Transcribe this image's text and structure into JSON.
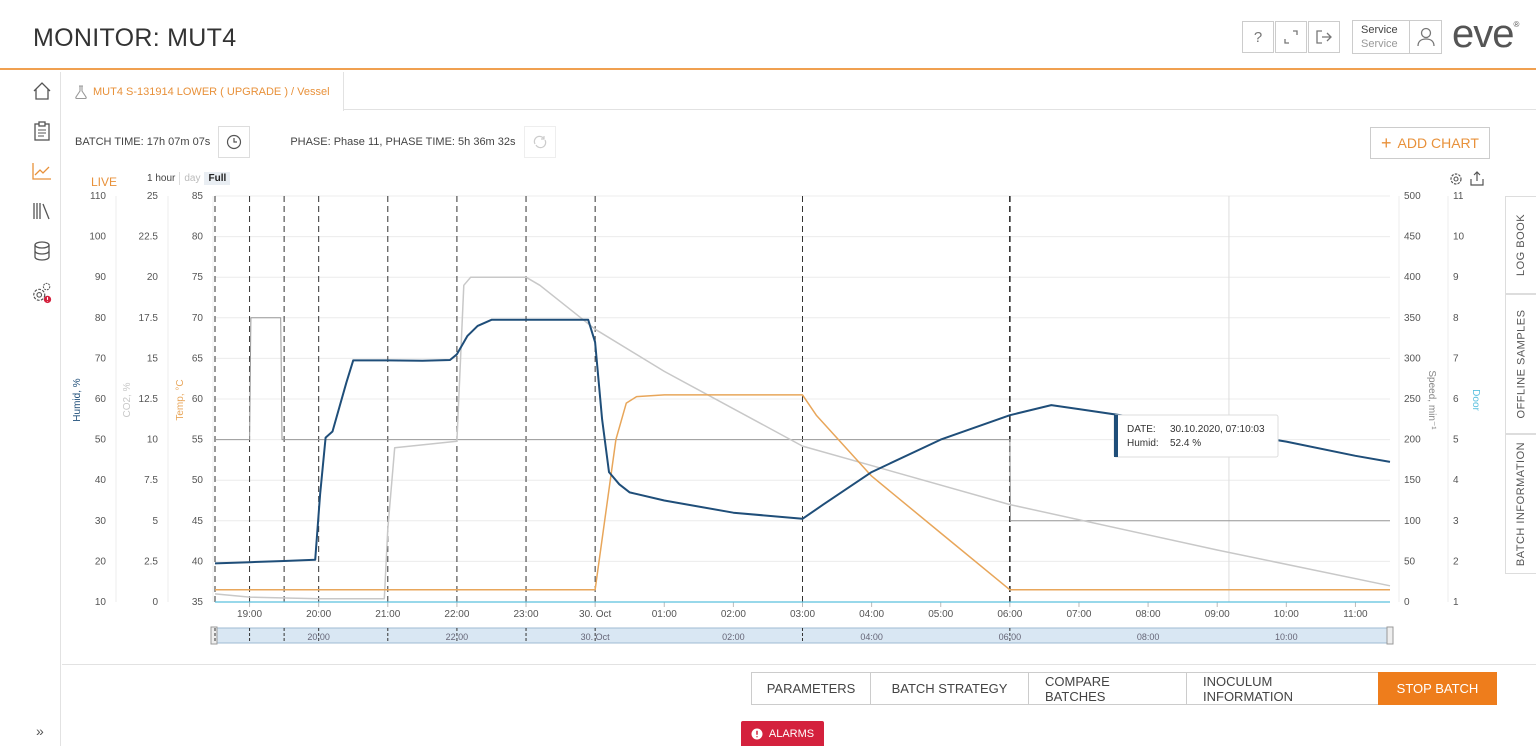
{
  "header": {
    "title": "MONITOR: MUT4",
    "help_icon": "?",
    "user_role": "Service",
    "user_name": "Service",
    "logo": "eve",
    "logo_mark": "®"
  },
  "tab": {
    "label": "MUT4 S-131914 LOWER ( UPGRADE ) / Vessel"
  },
  "info": {
    "batch_time": "BATCH TIME: 17h 07m 07s",
    "phase": "PHASE: Phase 11, PHASE TIME: 5h 36m 32s"
  },
  "add_chart_label": "ADD CHART",
  "live_label": "LIVE",
  "range": {
    "options": [
      "1 hour",
      "day",
      "Full"
    ],
    "selected": "Full"
  },
  "right_tabs": [
    "LOG BOOK",
    "OFFLINE SAMPLES",
    "BATCH INFORMATION"
  ],
  "actions": [
    "PARAMETERS",
    "BATCH STRATEGY",
    "COMPARE BATCHES",
    "INOCULUM INFORMATION"
  ],
  "stop_label": "STOP BATCH",
  "alarms_label": "ALARMS",
  "tooltip": {
    "date_label": "DATE:",
    "date": "30.10.2020, 07:10:03",
    "value_label": "Humid:",
    "value": "52.4 %"
  },
  "colors": {
    "accent": "#e8913a",
    "humid": "#1f4e79",
    "temp": "#e8a65a",
    "co2": "#c8c8c8",
    "speed": "#999999",
    "door": "#5bc0de",
    "stop": "#ee7d1c",
    "alarm": "#d4213d"
  },
  "chart_data": {
    "type": "line",
    "x_ticks": [
      "19:00",
      "20:00",
      "21:00",
      "22:00",
      "23:00",
      "30. Oct",
      "01:00",
      "02:00",
      "03:00",
      "04:00",
      "05:00",
      "06:00",
      "07:00",
      "08:00",
      "09:00",
      "10:00",
      "11:00"
    ],
    "navigator_ticks": [
      "20:00",
      "22:00",
      "30. Oct",
      "02:00",
      "04:00",
      "06:00",
      "08:00",
      "10:00"
    ],
    "axes": [
      {
        "name": "Humid, %",
        "ticks": [
          10,
          20,
          30,
          40,
          50,
          60,
          70,
          80,
          90,
          100,
          110
        ],
        "range": [
          10,
          110
        ]
      },
      {
        "name": "CO2, %",
        "ticks": [
          "0",
          "2.5",
          "5",
          "7.5",
          "10",
          "12.5",
          "15",
          "17.5",
          "20",
          "22.5",
          "25"
        ],
        "range": [
          0,
          25
        ]
      },
      {
        "name": "Temp, °C",
        "ticks": [
          35,
          40,
          45,
          50,
          55,
          60,
          65,
          70,
          75,
          80,
          85
        ],
        "range": [
          35,
          85
        ]
      },
      {
        "name": "Speed, min⁻¹",
        "ticks": [
          0,
          50,
          100,
          150,
          200,
          250,
          300,
          350,
          400,
          450,
          500
        ],
        "range": [
          0,
          500
        ]
      },
      {
        "name": "Door",
        "ticks": [
          1,
          2,
          3,
          4,
          5,
          6,
          7,
          8,
          9,
          10,
          11
        ],
        "range": [
          1,
          11
        ]
      }
    ],
    "x_range_hours": [
      18.5,
      35.5
    ],
    "phase_lines_hours": [
      18.5,
      19.0,
      19.5,
      20.0,
      21.0,
      22.0,
      23.0,
      24.0,
      27.0,
      30.0
    ],
    "series": [
      {
        "name": "Humid",
        "axis": "Humid, %",
        "x": [
          18.5,
          19.0,
          19.5,
          19.95,
          20.02,
          20.1,
          20.2,
          20.3,
          20.4,
          20.5,
          21.0,
          21.5,
          21.9,
          22.0,
          22.15,
          22.3,
          22.5,
          23.0,
          23.5,
          23.9,
          24.0,
          24.1,
          24.2,
          24.35,
          24.5,
          25.0,
          26.0,
          27.0,
          27.3,
          28.0,
          29.0,
          30.0,
          30.6,
          31.0,
          32.0,
          33.0,
          34.0,
          35.0,
          35.5
        ],
        "y": [
          19.5,
          19.8,
          20.1,
          20.4,
          36.5,
          50.5,
          52,
          58,
          64,
          69.5,
          69.5,
          69.4,
          69.6,
          71,
          75.5,
          78,
          79.5,
          79.5,
          79.5,
          79.5,
          74,
          55,
          42,
          39,
          37,
          35,
          32,
          30.5,
          34,
          42,
          50,
          56,
          58.5,
          57.5,
          55,
          52.3,
          49.5,
          46,
          44.5
        ]
      },
      {
        "name": "Temp",
        "axis": "Temp, °C",
        "x": [
          18.5,
          24.0,
          24.3,
          24.45,
          24.6,
          25.0,
          27.0,
          27.2,
          28.0,
          29.0,
          30.0,
          35.5
        ],
        "y": [
          36.5,
          36.5,
          55,
          59.5,
          60.3,
          60.5,
          60.5,
          58,
          50.5,
          43.5,
          36.5,
          36.5
        ]
      },
      {
        "name": "CO2",
        "axis": "CO2, %",
        "x": [
          18.5,
          19.0,
          20.0,
          20.95,
          21.0,
          21.1,
          22.0,
          22.1,
          22.2,
          22.3,
          23.0,
          23.2,
          24.0,
          25.0,
          27.0,
          30.0,
          33.0,
          35.5
        ],
        "y": [
          0.5,
          0.3,
          0.2,
          0.2,
          4.5,
          9.5,
          9.9,
          19.5,
          20.0,
          20.0,
          20.0,
          19.5,
          16.8,
          14.2,
          9.6,
          6.0,
          3.2,
          1.0
        ]
      },
      {
        "name": "Speed",
        "axis": "Speed, min⁻¹",
        "x": [
          18.5,
          19.0,
          19.02,
          19.45,
          19.47,
          19.95,
          20.0,
          21.0,
          22.0,
          24.0,
          26.0,
          28.0,
          30.0,
          30.01,
          32.0,
          35.5
        ],
        "y": [
          200,
          200,
          350,
          350,
          200,
          200,
          200,
          200,
          200,
          200,
          200,
          200,
          200,
          100,
          100,
          100
        ]
      },
      {
        "name": "Door",
        "axis": "Door",
        "x": [
          18.5,
          35.5
        ],
        "y": [
          1,
          1
        ]
      }
    ]
  }
}
